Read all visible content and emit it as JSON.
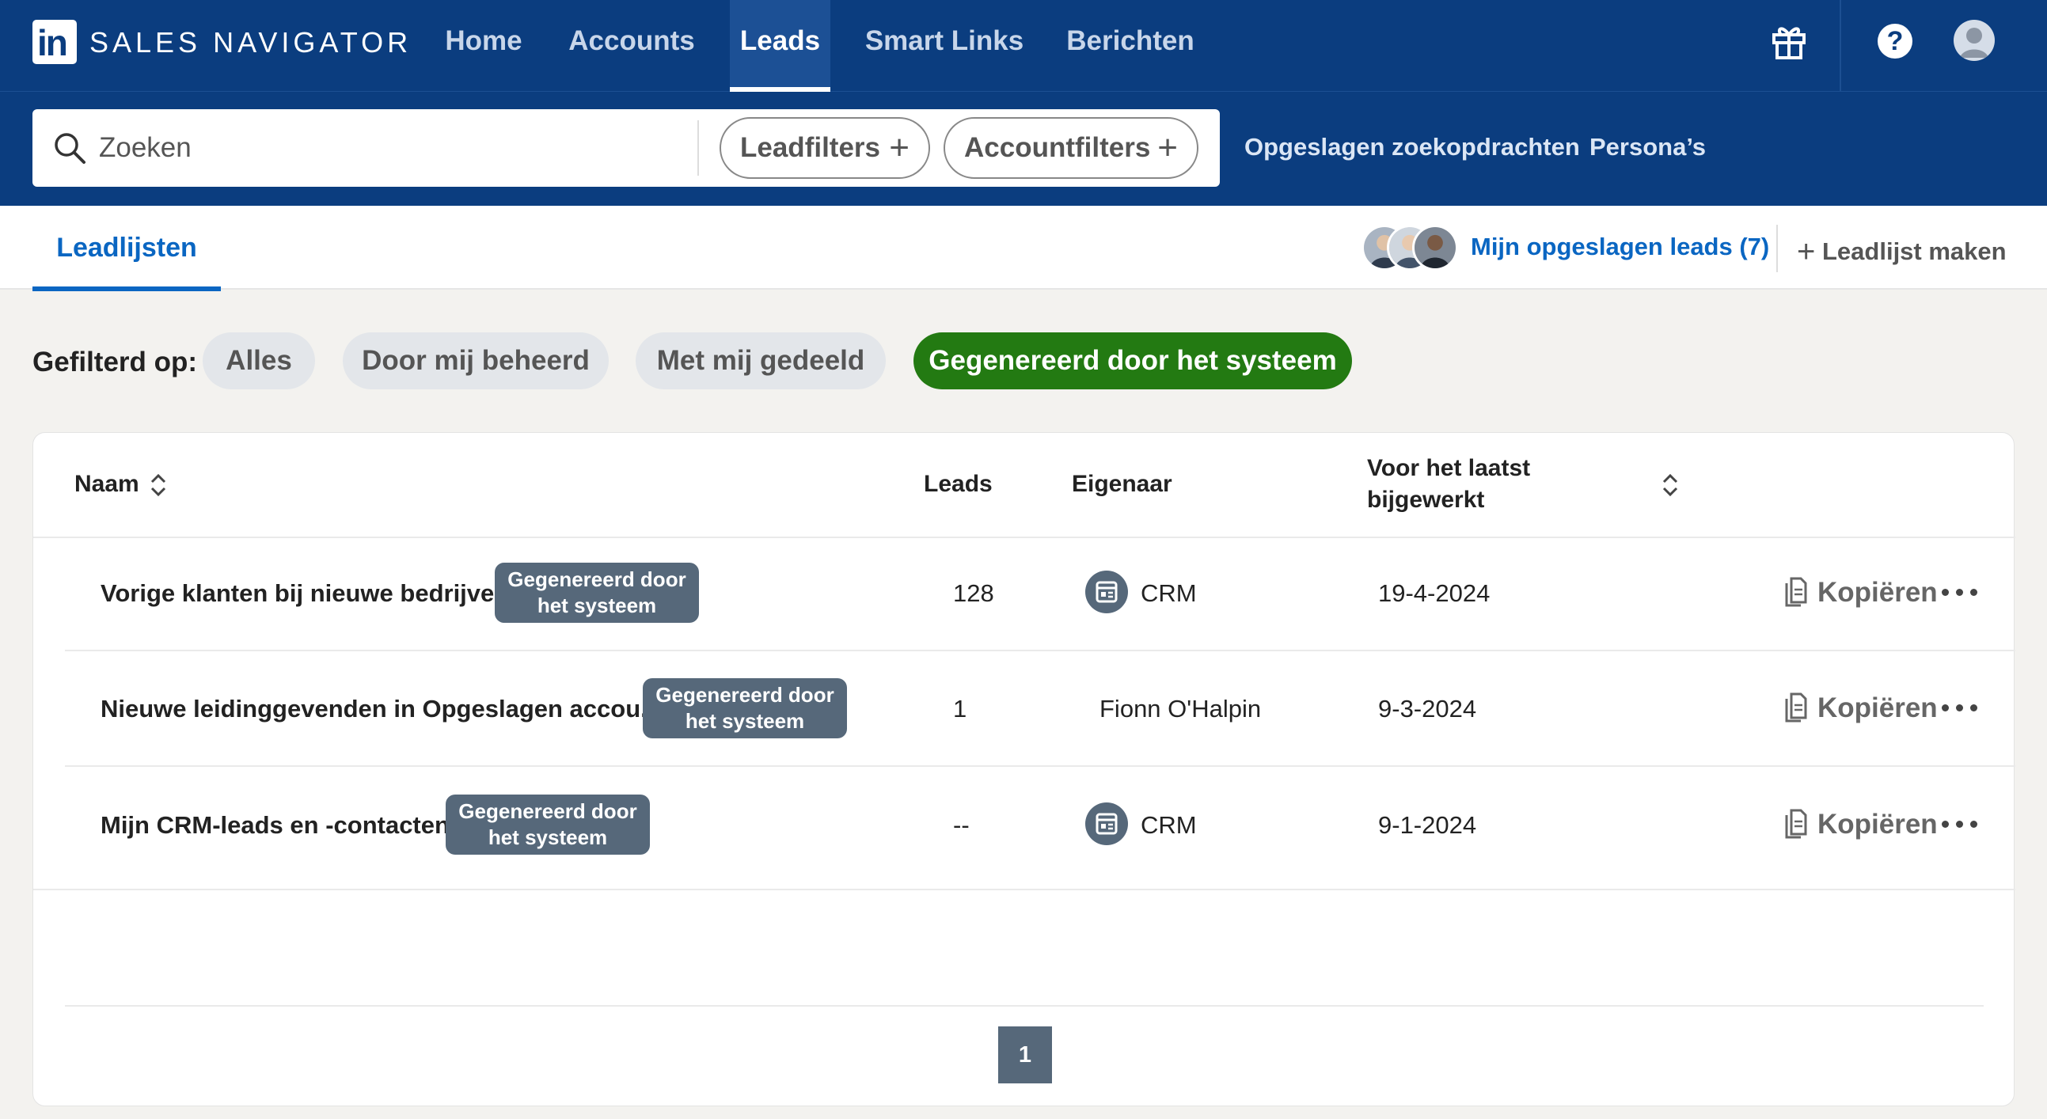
{
  "brand": {
    "logo_text": "in",
    "name": "SALES NAVIGATOR"
  },
  "nav": {
    "items": [
      {
        "label": "Home"
      },
      {
        "label": "Accounts"
      },
      {
        "label": "Leads",
        "active": true
      },
      {
        "label": "Smart Links"
      },
      {
        "label": "Berichten"
      }
    ],
    "icons": [
      "gift-icon",
      "help-icon",
      "avatar"
    ],
    "help_glyph": "?"
  },
  "search": {
    "placeholder": "Zoeken",
    "lead_filters_label": "Leadfilters",
    "account_filters_label": "Accountfilters",
    "saved_searches_link": "Opgeslagen zoekopdrachten",
    "personas_link": "Persona’s"
  },
  "tabs": {
    "active_tab": "Leadlijsten",
    "saved_leads_link": "Mijn opgeslagen leads (7)",
    "new_list_label": "Leadlijst maken"
  },
  "filters": {
    "label": "Gefilterd op:",
    "chips": [
      {
        "label": "Alles"
      },
      {
        "label": "Door mij beheerd"
      },
      {
        "label": "Met mij gedeeld"
      },
      {
        "label": "Gegenereerd door het systeem",
        "active": true
      }
    ]
  },
  "table": {
    "headers": {
      "name": "Naam",
      "leads": "Leads",
      "owner": "Eigenaar",
      "updated_line1": "Voor het laatst",
      "updated_line2": "bijgewerkt"
    },
    "badge_line1": "Gegenereerd door",
    "badge_line2": "het systeem",
    "copy_label": "Kopiëren",
    "rows": [
      {
        "name": "Vorige klanten bij nieuwe bedrijven",
        "leads": "128",
        "owner": "CRM",
        "owner_icon": "crm-icon",
        "updated": "19-4-2024"
      },
      {
        "name": "Nieuwe leidinggevenden in Opgeslagen accou...",
        "leads": "1",
        "owner": "Fionn O'Halpin",
        "owner_icon": "",
        "updated": "9-3-2024"
      },
      {
        "name": "Mijn CRM-leads en -contacten",
        "leads": "--",
        "owner": "CRM",
        "owner_icon": "crm-icon",
        "updated": "9-1-2024"
      }
    ]
  },
  "pagination": {
    "current_page": "1"
  },
  "colors": {
    "nav_bg": "#0b3d7f",
    "accent": "#0a66c2",
    "active_chip": "#237a12",
    "badge": "#56687a"
  }
}
